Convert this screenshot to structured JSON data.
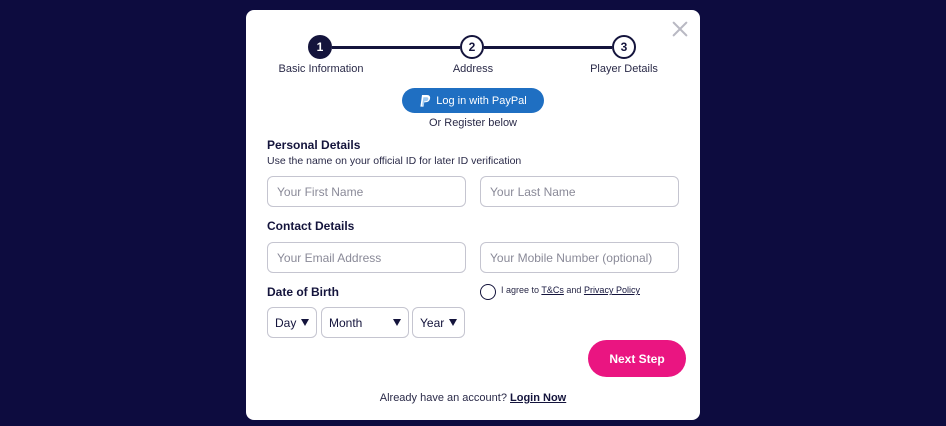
{
  "steps": [
    {
      "number": "1",
      "label": "Basic Information",
      "active": true
    },
    {
      "number": "2",
      "label": "Address",
      "active": false
    },
    {
      "number": "3",
      "label": "Player Details",
      "active": false
    }
  ],
  "paypal": {
    "label": "Log in with PayPal",
    "icon": "paypal-icon"
  },
  "register_below": "Or Register below",
  "personal": {
    "title": "Personal Details",
    "subtitle": "Use the name on your official ID for later ID verification",
    "first_name_placeholder": "Your First Name",
    "last_name_placeholder": "Your Last Name"
  },
  "contact": {
    "title": "Contact Details",
    "email_placeholder": "Your Email Address",
    "mobile_placeholder": "Your Mobile Number (optional)"
  },
  "dob": {
    "title": "Date of Birth",
    "day": "Day",
    "month": "Month",
    "year": "Year"
  },
  "terms": {
    "prefix": "I agree to",
    "tcs": "T&Cs",
    "and": "and",
    "privacy": "Privacy Policy"
  },
  "next_button": "Next Step",
  "footer": {
    "text": "Already have an account?",
    "link": "Login Now"
  },
  "colors": {
    "background": "#0d0c3f",
    "accent": "#ea1581",
    "paypal": "#1f6fc2",
    "primary": "#14143c"
  }
}
